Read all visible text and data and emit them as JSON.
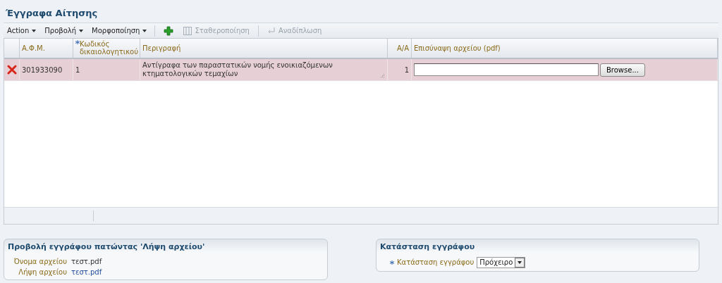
{
  "page_title": "Έγγραφα Αίτησης",
  "toolbar": {
    "menus": [
      {
        "label": "Action"
      },
      {
        "label": "Προβολή"
      },
      {
        "label": "Μορφοποίηση"
      }
    ],
    "buttons": [
      {
        "kind": "add",
        "disabled": false
      },
      {
        "kind": "freeze",
        "label": "Σταθεροποίηση",
        "disabled": true
      },
      {
        "kind": "wrap",
        "label": "Αναδίπλωση",
        "disabled": true
      }
    ]
  },
  "table": {
    "columns": [
      {
        "label": "Α.Φ.Μ.",
        "required": false
      },
      {
        "label": "Κωδικός δικαιολογητικού",
        "required": true
      },
      {
        "label": "Περιγραφή",
        "required": false
      },
      {
        "label": "Α/Α",
        "required": false
      },
      {
        "label": "Επισύναψη αρχείου (pdf)",
        "required": false
      }
    ],
    "rows": [
      {
        "selected": true,
        "afm": "301933090",
        "code": "1",
        "description": "Αντίγραφα των παραστατικών νομής ενοικιαζόμενων κτηματολογικών τεμαχίων",
        "aa": "1",
        "browse_label": "Browse..."
      }
    ]
  },
  "preview_panel": {
    "title": "Προβολή εγγράφου πατώντας 'Λήψη αρχείου'",
    "fields": [
      {
        "label": "Όνομα αρχείου",
        "value": "τεστ.pdf",
        "kind": "text"
      },
      {
        "label": "Λήψη αρχείου",
        "value": "τεστ.pdf",
        "kind": "link"
      }
    ]
  },
  "status_panel": {
    "title": "Κατάσταση εγγράφου",
    "field": {
      "label": "Κατάσταση εγγράφου",
      "required": true,
      "value": "Πρόχειρο"
    }
  }
}
